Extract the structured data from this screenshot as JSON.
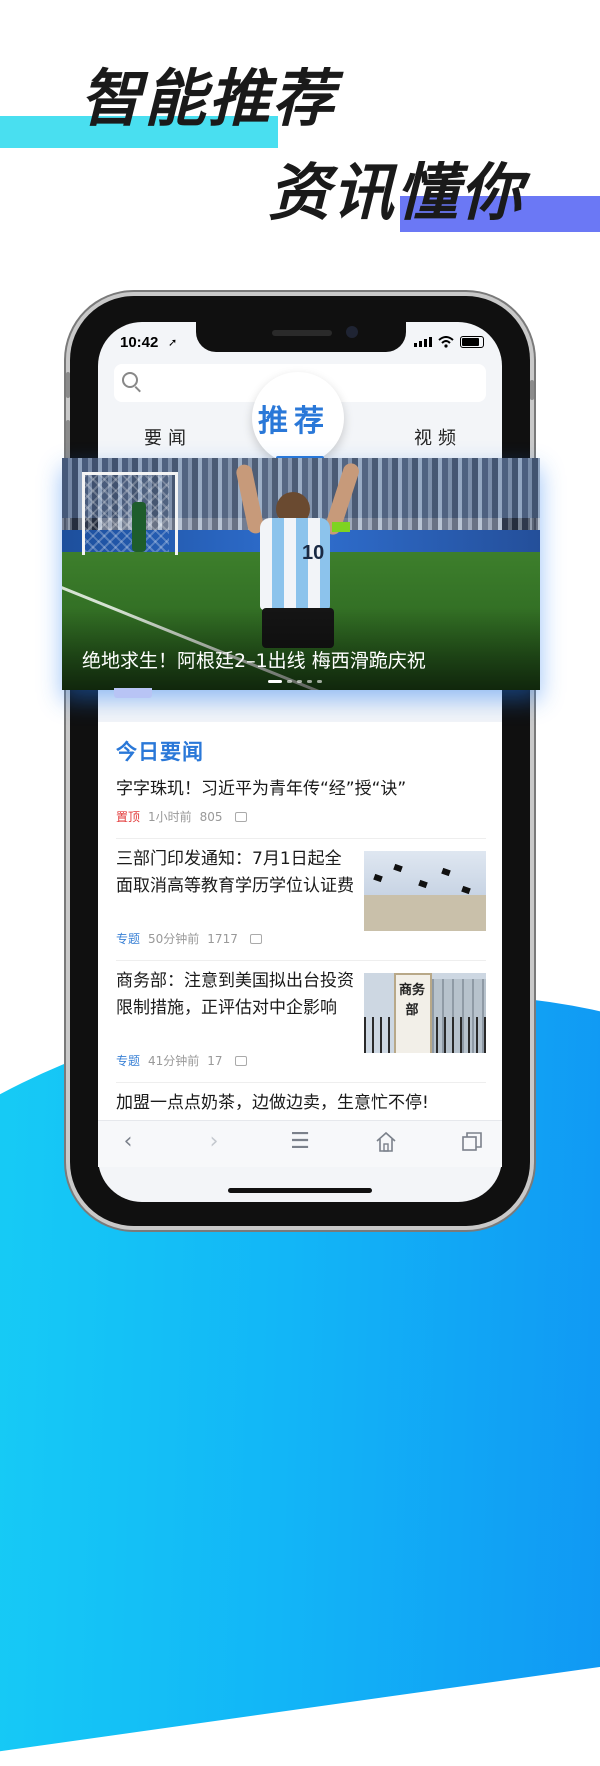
{
  "headline": {
    "line1": "智能推荐",
    "line2": "资讯懂你"
  },
  "status_bar": {
    "time": "10:42"
  },
  "search": {
    "placeholder": ""
  },
  "tabs": [
    {
      "label": "要闻",
      "active": false
    },
    {
      "label": "推荐",
      "active": true
    },
    {
      "label": "视频",
      "active": false
    }
  ],
  "banner": {
    "caption": "绝地求生！阿根廷2–1出线 梅西滑跪庆祝",
    "jersey_number": "10",
    "slide_count": 5,
    "active_slide": 1
  },
  "news_section": {
    "title": "今日要闻",
    "items": [
      {
        "title": "字字珠玑！习近平为青年传“经”授“诀”",
        "tag": "置顶",
        "time": "1小时前",
        "comments": "805"
      },
      {
        "title": "三部门印发通知：7月1日起全面取消高等教育学历学位认证费",
        "tag": "专题",
        "time": "50分钟前",
        "comments": "1717"
      },
      {
        "title": "商务部：注意到美国拟出台投资限制措施，正评估对中企影响",
        "tag": "专题",
        "time": "41分钟前",
        "comments": "17",
        "thumb_text": "商务部"
      },
      {
        "title": "加盟一点点奶茶，边做边卖，生意忙不停!"
      }
    ]
  },
  "colors": {
    "accent_blue": "#2a78d8",
    "cyan_bar": "#49dff0",
    "purple_bar": "#6b78f5",
    "tag_red": "#e23a3a"
  },
  "bottom_bar": {
    "icons": [
      "back-icon",
      "forward-icon",
      "menu-icon",
      "home-icon",
      "tabs-icon"
    ]
  }
}
